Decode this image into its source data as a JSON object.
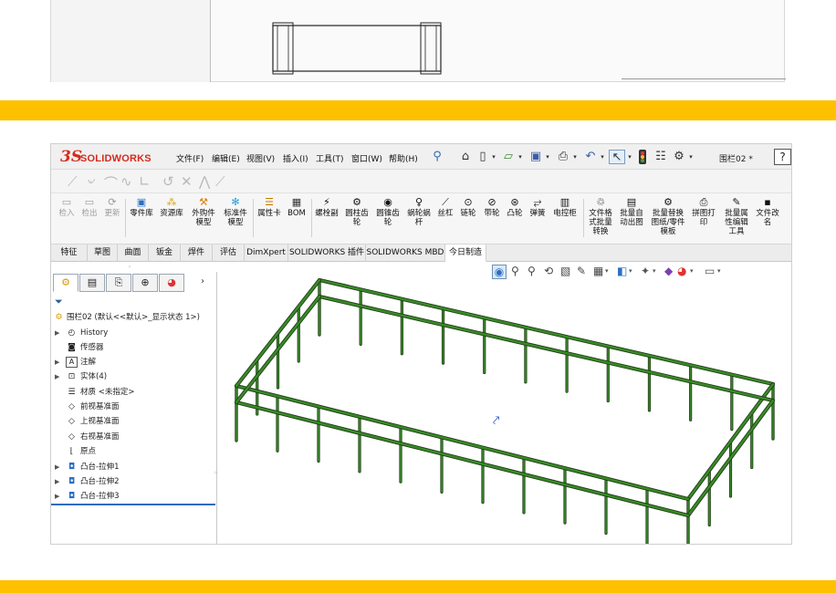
{
  "brand": {
    "accent_band_color": "#ffc000",
    "solidworks_red": "#d52b1e",
    "rail_green": "#3a8a2a",
    "logo_ds": "3S",
    "logo_text": "SOLIDWORKS"
  },
  "titlebar": {
    "menus": [
      "文件(F)",
      "编辑(E)",
      "视图(V)",
      "插入(I)",
      "工具(T)",
      "窗口(W)",
      "帮助(H)"
    ],
    "document_title": "围栏02 *",
    "help_label": "?"
  },
  "ribbon": {
    "pdm_buttons": [
      "检入",
      "检出",
      "更新"
    ],
    "groups": [
      {
        "icon": "part-library-icon",
        "label": "零件库"
      },
      {
        "icon": "resource-library-icon",
        "label": "资源库"
      },
      {
        "icon": "purchased-model-icon",
        "label": "外购件\n模型"
      },
      {
        "icon": "standard-model-icon",
        "label": "标准件\n模型"
      },
      {
        "icon": "property-card-icon",
        "label": "属性卡"
      },
      {
        "icon": "bom-icon",
        "label": "BOM"
      },
      {
        "icon": "bolt-icon",
        "label": "螺栓副"
      },
      {
        "icon": "cylindrical-gear-icon",
        "label": "圆柱齿\n轮"
      },
      {
        "icon": "bevel-gear-icon",
        "label": "圆锥齿\n轮"
      },
      {
        "icon": "worm-gear-icon",
        "label": "蜗轮蜗\n杆"
      },
      {
        "icon": "lead-screw-icon",
        "label": "丝杠"
      },
      {
        "icon": "sprocket-icon",
        "label": "链轮"
      },
      {
        "icon": "pulley-icon",
        "label": "带轮"
      },
      {
        "icon": "cam-icon",
        "label": "凸轮"
      },
      {
        "icon": "spring-icon",
        "label": "弹簧"
      },
      {
        "icon": "control-cabinet-icon",
        "label": "电控柜"
      },
      {
        "icon": "batch-format-icon",
        "label": "文件格\n式批量\n转换"
      },
      {
        "icon": "auto-drawing-icon",
        "label": "批量自\n动出图"
      },
      {
        "icon": "batch-replace-icon",
        "label": "批量替换\n图纸/零件\n模板"
      },
      {
        "icon": "print-icon",
        "label": "拼图打\n印"
      },
      {
        "icon": "batch-property-icon",
        "label": "批量属\n性编辑\n工具"
      },
      {
        "icon": "rename-icon",
        "label": "文件改\n名"
      }
    ]
  },
  "tabs": [
    "特征",
    "草图",
    "曲面",
    "钣金",
    "焊件",
    "评估",
    "DimXpert",
    "SOLIDWORKS 插件",
    "SOLIDWORKS MBD",
    "今日制造"
  ],
  "active_tab": "今日制造",
  "feature_tree": {
    "root": "围栏02 (默认<<默认>_显示状态 1>)",
    "items": [
      {
        "label": "History",
        "icon": "history-icon",
        "expandable": true
      },
      {
        "label": "传感器",
        "icon": "sensor-icon",
        "expandable": false
      },
      {
        "label": "注解",
        "icon": "annotation-icon",
        "expandable": true
      },
      {
        "label": "实体(4)",
        "icon": "solid-body-icon",
        "expandable": true
      },
      {
        "label": "材质 <未指定>",
        "icon": "material-icon",
        "expandable": false
      },
      {
        "label": "前视基准面",
        "icon": "plane-icon",
        "expandable": false
      },
      {
        "label": "上视基准面",
        "icon": "plane-icon",
        "expandable": false
      },
      {
        "label": "右视基准面",
        "icon": "plane-icon",
        "expandable": false
      },
      {
        "label": "原点",
        "icon": "origin-icon",
        "expandable": false
      },
      {
        "label": "凸台-拉伸1",
        "icon": "extrude-icon",
        "expandable": true
      },
      {
        "label": "凸台-拉伸2",
        "icon": "extrude-icon",
        "expandable": true
      },
      {
        "label": "凸台-拉伸3",
        "icon": "extrude-icon",
        "expandable": true
      }
    ]
  }
}
